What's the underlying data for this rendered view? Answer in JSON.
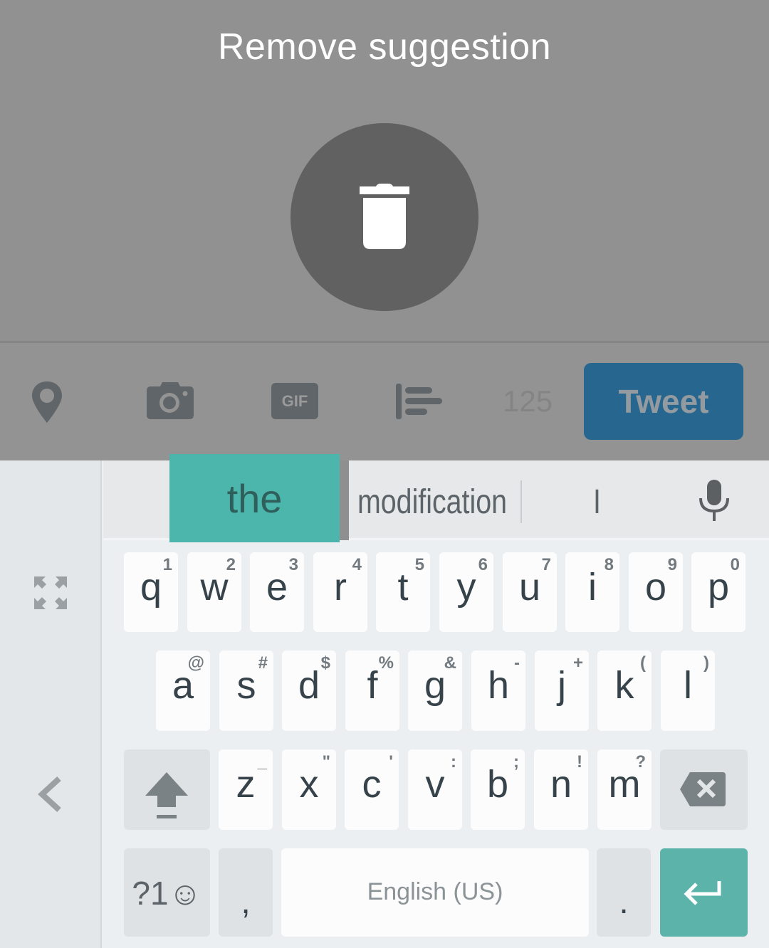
{
  "overlay": {
    "title": "Remove suggestion",
    "action_icon": "trash-icon"
  },
  "toolbar": {
    "icons": [
      "location-pin-icon",
      "camera-icon",
      "gif-icon",
      "poll-icon"
    ],
    "gif_label": "GIF",
    "char_counter": "125",
    "tweet_label": "Tweet",
    "colors": {
      "tweet_bg": "#27678f",
      "overlay_bg": "#919191"
    }
  },
  "keyboard": {
    "suggestions": [
      "the",
      "modification",
      "I"
    ],
    "selected_suggestion": "the",
    "accent": "#4db6ac",
    "rows": [
      [
        {
          "key": "q",
          "hint": "1"
        },
        {
          "key": "w",
          "hint": "2"
        },
        {
          "key": "e",
          "hint": "3"
        },
        {
          "key": "r",
          "hint": "4"
        },
        {
          "key": "t",
          "hint": "5"
        },
        {
          "key": "y",
          "hint": "6"
        },
        {
          "key": "u",
          "hint": "7"
        },
        {
          "key": "i",
          "hint": "8"
        },
        {
          "key": "o",
          "hint": "9"
        },
        {
          "key": "p",
          "hint": "0"
        }
      ],
      [
        {
          "key": "a",
          "hint": "@"
        },
        {
          "key": "s",
          "hint": "#"
        },
        {
          "key": "d",
          "hint": "$"
        },
        {
          "key": "f",
          "hint": "%"
        },
        {
          "key": "g",
          "hint": "&"
        },
        {
          "key": "h",
          "hint": "-"
        },
        {
          "key": "j",
          "hint": "+"
        },
        {
          "key": "k",
          "hint": "("
        },
        {
          "key": "l",
          "hint": ")"
        }
      ],
      [
        {
          "key": "z",
          "hint": "_"
        },
        {
          "key": "x",
          "hint": "\""
        },
        {
          "key": "c",
          "hint": "'"
        },
        {
          "key": "v",
          "hint": ":"
        },
        {
          "key": "b",
          "hint": ";"
        },
        {
          "key": "n",
          "hint": "!"
        },
        {
          "key": "m",
          "hint": "?"
        }
      ]
    ],
    "symbols_key": "?1☺",
    "comma_key": ",",
    "space_label": "English (US)",
    "period_key": ".",
    "side_icons": [
      "expand-icon",
      "chevron-left-icon"
    ]
  }
}
